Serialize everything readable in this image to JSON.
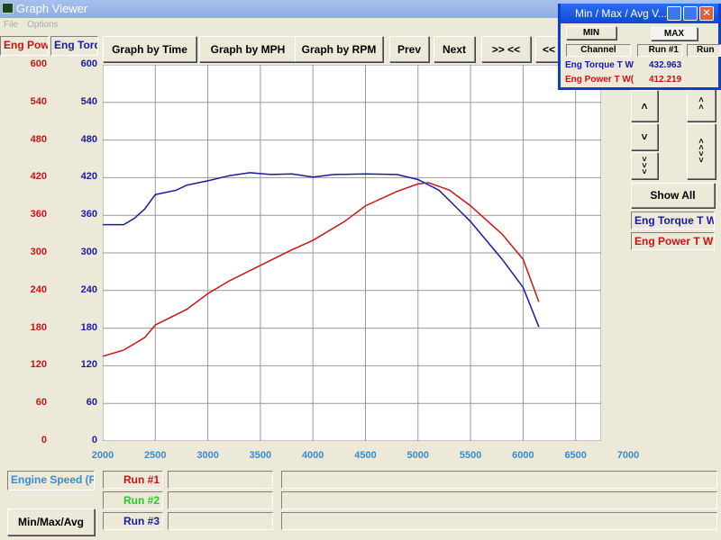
{
  "window": {
    "title": "Graph Viewer",
    "menu": [
      "File",
      "Options"
    ]
  },
  "channels": {
    "left1": "Eng Powe",
    "left2": "Eng Torq"
  },
  "toolbar": [
    "Graph by Time",
    "Graph by MPH",
    "Graph by RPM",
    "Prev",
    "Next",
    ">> <<",
    "<<"
  ],
  "side": {
    "show_all": "Show All",
    "legend1": "Eng Torque T W",
    "legend2": "Eng Power T WC",
    "icons": [
      "chevron-up-icon",
      "chevron-down-icon",
      "triple-chevron-down-icon",
      "double-chevron-up-icon",
      "chevron-updown-icon"
    ]
  },
  "bottom": {
    "axis_channel": "Engine Speed (RI",
    "runs": [
      "Run #1",
      "Run #2",
      "Run #3"
    ],
    "run_colors": [
      "#c81414",
      "#22cc22",
      "#1a1aa0"
    ],
    "minmax_btn": "Min/Max/Avg"
  },
  "popup": {
    "title": "Min / Max / Avg V...",
    "min": "MIN",
    "max": "MAX",
    "col_channel": "Channel",
    "col_run1": "Run #1",
    "col_run2": "Run",
    "rows": [
      {
        "name": "Eng Torque T W",
        "value": "432.963"
      },
      {
        "name": "Eng Power T W(",
        "value": "412.219"
      }
    ]
  },
  "chart_data": {
    "type": "line",
    "xlim": [
      2000,
      7000
    ],
    "ylim": [
      0,
      600
    ],
    "grid": true,
    "xticks": [
      "2000",
      "2500",
      "3000",
      "3500",
      "4000",
      "4500",
      "5000",
      "5500",
      "6000",
      "6500",
      "7000"
    ],
    "yticks_left": [
      "600",
      "540",
      "480",
      "420",
      "360",
      "300",
      "240",
      "180",
      "120",
      "60",
      "0"
    ],
    "yticks_right": [
      "600",
      "540",
      "480",
      "420",
      "360",
      "300",
      "240",
      "180",
      "120",
      "60",
      "0"
    ],
    "series": [
      {
        "color": "#1a1aa0",
        "x": [
          2000,
          2200,
          2300,
          2400,
          2500,
          2700,
          2800,
          3000,
          3200,
          3400,
          3600,
          3800,
          4000,
          4200,
          4500,
          4800,
          5000,
          5200,
          5500,
          5800,
          6000,
          6150
        ],
        "y": [
          345,
          345,
          355,
          370,
          393,
          400,
          408,
          415,
          423,
          428,
          425,
          426,
          421,
          425,
          426,
          425,
          417,
          400,
          350,
          290,
          245,
          182
        ]
      },
      {
        "color": "#c81414",
        "x": [
          2000,
          2200,
          2400,
          2500,
          2800,
          3000,
          3200,
          3500,
          3800,
          4000,
          4300,
          4500,
          4800,
          5000,
          5100,
          5300,
          5500,
          5800,
          6000,
          6150
        ],
        "y": [
          135,
          145,
          165,
          185,
          210,
          235,
          255,
          280,
          305,
          320,
          350,
          375,
          398,
          410,
          412,
          400,
          375,
          330,
          290,
          222
        ]
      }
    ]
  }
}
